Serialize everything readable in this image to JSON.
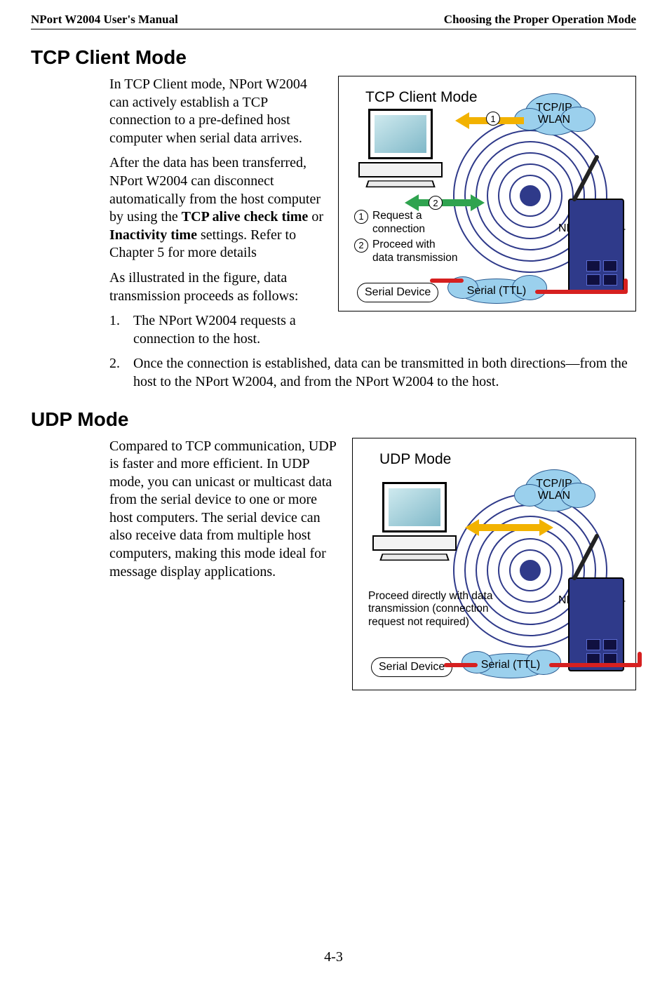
{
  "header": {
    "left": "NPort W2004 User's Manual",
    "right": "Choosing the Proper Operation Mode"
  },
  "section1": {
    "title": "TCP Client Mode",
    "p1a": "In TCP Client mode, NPort W2004 can actively establish a TCP connection to a pre-defined host computer when serial data arrives.",
    "p2a": "After the data has been transferred, NPort W2004 can disconnect automatically from the host computer by using the ",
    "p2b": "TCP alive check time",
    "p2c": " or ",
    "p2d": "Inactivity time",
    "p2e": " settings. Refer to Chapter 5 for more details",
    "p3a": "As illustrated in the figure, data transmission proceeds as follows:",
    "li1": "The NPort W2004 requests a connection to the host.",
    "li2": "Once the connection is established, data can be transmitted in both directions—from the host to the NPort W2004, and from the NPort W2004 to the host."
  },
  "section2": {
    "title": "UDP Mode",
    "p1": "Compared to TCP communication, UDP is faster and more efficient. In UDP mode, you can unicast or multicast data from the serial device to one or more host computers. The serial device can also receive data from multiple host computers, making this mode ideal for message display applications."
  },
  "fig1": {
    "title": "TCP Client Mode",
    "cloud_tcpip_l1": "TCP/IP",
    "cloud_tcpip_l2": "WLAN",
    "nport": "NPort W2004",
    "serial_ttl": "Serial (TTL)",
    "serial_device": "Serial Device",
    "num1": "1",
    "num2": "2",
    "legend1a": "Request a",
    "legend1b": "connection",
    "legend2a": "Proceed with",
    "legend2b": "data transmission"
  },
  "fig2": {
    "title": "UDP Mode",
    "cloud_tcpip_l1": "TCP/IP",
    "cloud_tcpip_l2": "WLAN",
    "nport": "NPort W2004",
    "serial_ttl": "Serial (TTL)",
    "serial_device": "Serial Device",
    "note_l1": "Proceed directly with data",
    "note_l2": "transmission (connection",
    "note_l3": "request not required)"
  },
  "page": "4-3"
}
